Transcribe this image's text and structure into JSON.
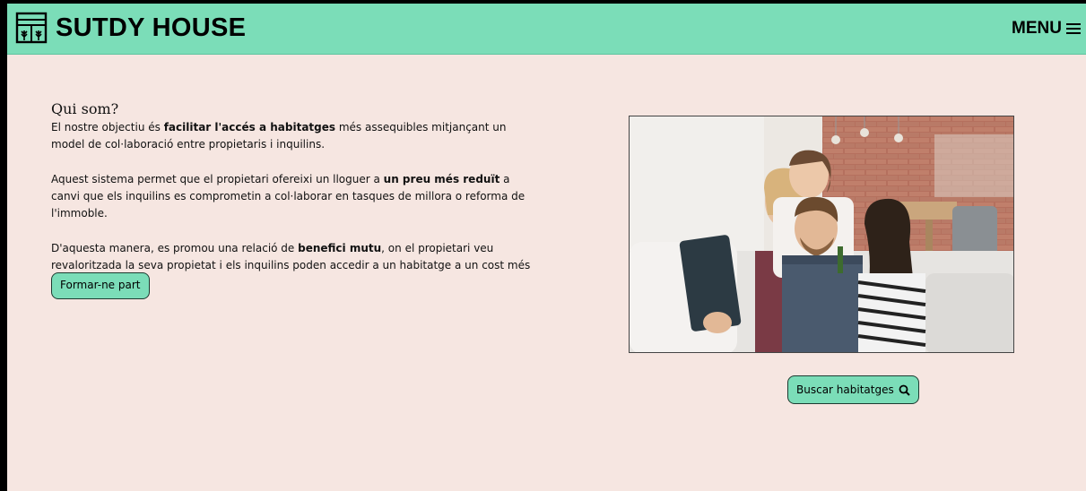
{
  "header": {
    "brand": "SUTDY HOUSE",
    "menu_label": "MENU",
    "background_color": "#7bddb8",
    "logo_icon": "house-window-icon",
    "menu_icon": "hamburger-icon"
  },
  "about": {
    "title": "Qui som?",
    "p1": {
      "a": "El nostre objectiu és ",
      "b": "facilitar l'accés a habitatges",
      "c": " més assequibles mitjançant un model de col·laboració entre propietaris i inquilins."
    },
    "p2": {
      "a": "Aquest sistema permet que el propietari ofereixi un lloguer a ",
      "b": "un preu més reduït",
      "c": " a canvi que els inquilins es comprometin a col·laborar en tasques de millora o reforma de l'immoble."
    },
    "p3": {
      "a": "D'aquesta manera, es promou una relació de ",
      "b": "benefici mutu",
      "c": ", on el propietari veu revaloritzada la seva propietat i els inquilins poden accedir a un habitatge a un cost més assequible."
    },
    "join_button": "Formar-ne part"
  },
  "search": {
    "button_label": "Buscar habitatges",
    "icon": "search-icon"
  },
  "colors": {
    "page_background": "#f6e6e1",
    "accent": "#7bddb8"
  }
}
